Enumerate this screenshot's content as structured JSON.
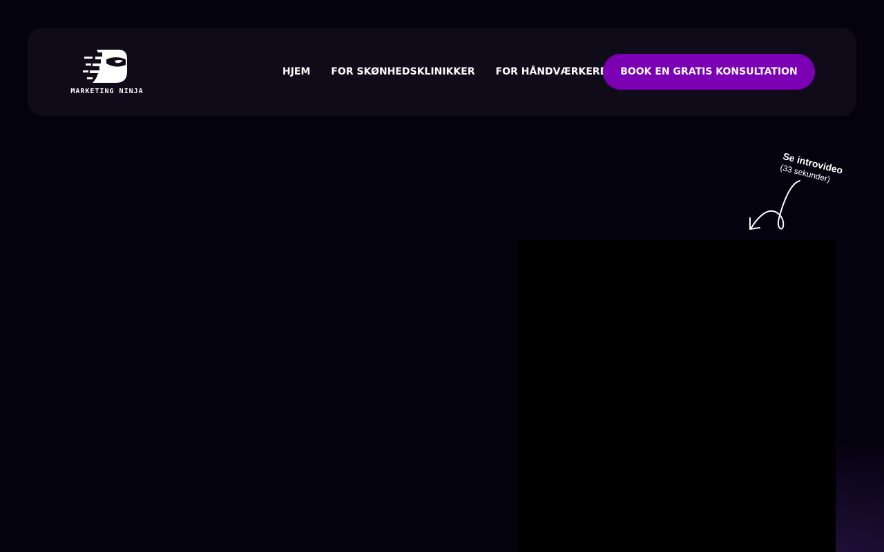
{
  "brand": {
    "name": "MARKETING NINJA",
    "logo_icon": "ninja-head-icon"
  },
  "nav": {
    "items": [
      {
        "label": "HJEM"
      },
      {
        "label": "FOR SKØNHEDSKLINIKKER"
      },
      {
        "label": "FOR HÅNDVÆRKERE"
      }
    ],
    "cta_label": "BOOK EN GRATIS KONSULTATION"
  },
  "intro": {
    "title": "Se introvideo",
    "subtitle": "(33 sekunder)",
    "arrow_icon": "curved-arrow-icon"
  },
  "colors": {
    "background": "#05020f",
    "header_bg": "#0f0b18",
    "accent": "#7b00b4",
    "text": "#ffffff",
    "video_bg": "#000000"
  }
}
